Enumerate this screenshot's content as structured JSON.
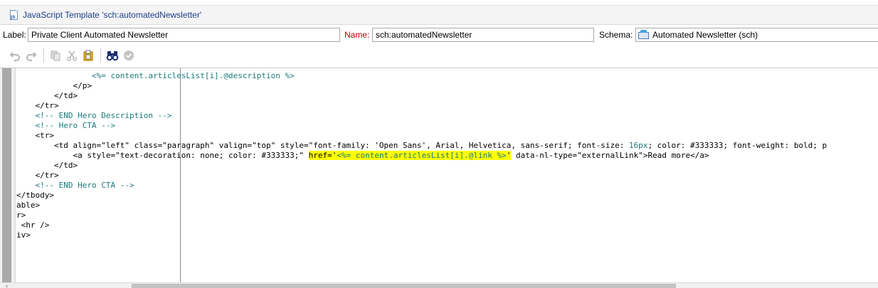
{
  "window": {
    "title": "JavaScript Template 'sch:automatedNewsletter'",
    "icon": "javascript-file-icon"
  },
  "form": {
    "label_caption": "Label:",
    "label_value": "Private Client Automated Newsletter",
    "name_caption": "Name:",
    "name_value": "sch:automatedNewsletter",
    "name_caption_color": "#c00000",
    "schema_caption": "Schema:",
    "schema_value": "Automated Newsletter (sch)",
    "schema_icon": "schema-icon"
  },
  "toolbar": {
    "buttons": [
      {
        "name": "undo-icon",
        "enabled": false
      },
      {
        "name": "redo-icon",
        "enabled": false
      },
      {
        "name": "copy-icon",
        "enabled": false
      },
      {
        "name": "cut-icon",
        "enabled": false
      },
      {
        "name": "paste-icon",
        "enabled": true
      },
      {
        "name": "find-icon",
        "enabled": true
      },
      {
        "name": "check-icon",
        "enabled": false
      }
    ]
  },
  "editor": {
    "lines": [
      [
        {
          "t": "                <",
          "c": "c-esc"
        },
        {
          "t": "%= content.articlesList[i].@description %>",
          "c": "c-esc"
        }
      ],
      [
        {
          "t": "            </p>",
          "c": "c-tag"
        }
      ],
      [
        {
          "t": "        </td>",
          "c": "c-tag"
        }
      ],
      [
        {
          "t": "    </tr>",
          "c": "c-tag"
        }
      ],
      [
        {
          "t": "    <!-- END Hero Description -->",
          "c": "c-com"
        }
      ],
      [
        {
          "t": "    <!-- Hero CTA -->",
          "c": "c-com"
        }
      ],
      [
        {
          "t": "    <tr>",
          "c": "c-tag"
        }
      ],
      [
        {
          "t": "        <td align=\"left\" class=\"paragraph\" valign=\"top\" style=\"font-family: 'Open Sans', Arial, Helvetica, sans-serif; font-size: ",
          "c": "c-tag"
        },
        {
          "t": "16px",
          "c": "c-esc"
        },
        {
          "t": "; color: #333333; font-weight: bold; p",
          "c": "c-tag"
        }
      ],
      [
        {
          "t": "            <a style=\"text-decoration: none; color: #333333;\" ",
          "c": "c-tag"
        },
        {
          "t": "href='",
          "c": "hl c-tag"
        },
        {
          "t": "<%= content.articlesList[i].@link %>",
          "c": "hl c-esc"
        },
        {
          "t": "'",
          "c": "hl c-tag"
        },
        {
          "t": " data-nl-type=\"externalLink\">Read more</a>",
          "c": "c-tag"
        }
      ],
      [
        {
          "t": "        </td>",
          "c": "c-tag"
        }
      ],
      [
        {
          "t": "    </tr>",
          "c": "c-tag"
        }
      ],
      [
        {
          "t": "    <!-- END Hero CTA -->",
          "c": "c-com"
        }
      ],
      [
        {
          "t": "</tbody>",
          "c": "c-tag"
        }
      ],
      [
        {
          "t": "able>",
          "c": "c-tag"
        }
      ],
      [
        {
          "t": "r>",
          "c": "c-tag"
        }
      ],
      [
        {
          "t": " <hr />",
          "c": "c-tag"
        }
      ],
      [
        {
          "t": "iv>",
          "c": "c-tag"
        }
      ]
    ]
  },
  "scrollbar": {
    "left_arrow": "‹"
  }
}
